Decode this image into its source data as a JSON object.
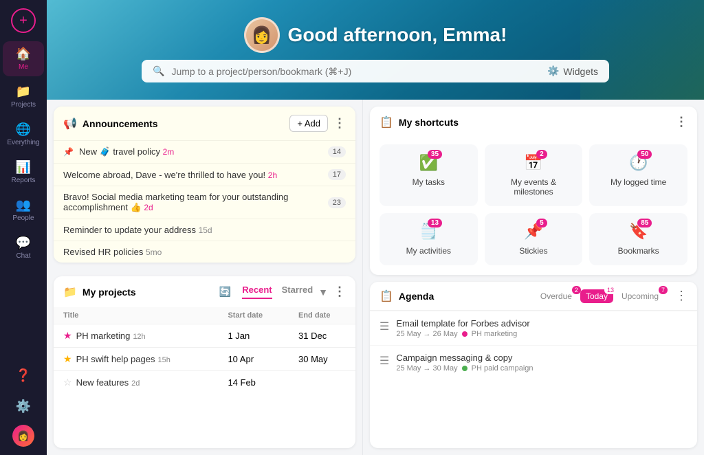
{
  "sidebar": {
    "add_label": "+",
    "items": [
      {
        "id": "me",
        "icon": "🏠",
        "label": "Me",
        "active": true
      },
      {
        "id": "projects",
        "icon": "📁",
        "label": "Projects",
        "active": false
      },
      {
        "id": "everything",
        "icon": "🌐",
        "label": "Everything",
        "active": false
      },
      {
        "id": "reports",
        "icon": "📊",
        "label": "Reports",
        "active": false
      },
      {
        "id": "people",
        "icon": "👥",
        "label": "People",
        "active": false
      },
      {
        "id": "chat",
        "icon": "💬",
        "label": "Chat",
        "active": false
      }
    ],
    "bottom": [
      {
        "id": "help",
        "icon": "❓"
      },
      {
        "id": "settings",
        "icon": "⚙️"
      }
    ]
  },
  "hero": {
    "greeting": "Good afternoon, Emma!",
    "avatar_emoji": "👩"
  },
  "search": {
    "placeholder": "Jump to a project/person/bookmark (⌘+J)",
    "widgets_label": "Widgets"
  },
  "announcements": {
    "title": "Announcements",
    "add_label": "+ Add",
    "items": [
      {
        "pinned": true,
        "text": "New 🧳 travel policy",
        "time": "2m",
        "count": "14"
      },
      {
        "pinned": false,
        "text": "Welcome abroad, Dave - we're thrilled to have you!",
        "time": "2h",
        "count": "17"
      },
      {
        "pinned": false,
        "text": "Bravo! Social media marketing team for your outstanding accomplishment 👍",
        "time": "2d",
        "count": "23"
      },
      {
        "pinned": false,
        "text": "Reminder to update your address",
        "time": "15d",
        "count": ""
      },
      {
        "pinned": false,
        "text": "Revised HR policies",
        "time": "5mo",
        "count": ""
      }
    ]
  },
  "shortcuts": {
    "title": "My shortcuts",
    "items": [
      {
        "icon": "✅",
        "label": "My tasks",
        "badge": "35"
      },
      {
        "icon": "📅",
        "label": "My events & milestones",
        "badge": "2"
      },
      {
        "icon": "🕐",
        "label": "My logged time",
        "badge": "50"
      },
      {
        "icon": "🗒️",
        "label": "My activities",
        "badge": "13"
      },
      {
        "icon": "📌",
        "label": "Stickies",
        "badge": "5"
      },
      {
        "icon": "🔖",
        "label": "Bookmarks",
        "badge": "85"
      }
    ]
  },
  "projects": {
    "title": "My projects",
    "tabs": [
      "Recent",
      "Starred"
    ],
    "active_tab": "Recent",
    "columns": [
      "Title",
      "Start date",
      "End date"
    ],
    "rows": [
      {
        "star": "filled",
        "name": "PH marketing",
        "time": "12h",
        "start": "1 Jan",
        "end": "31 Dec"
      },
      {
        "star": "half",
        "name": "PH swift help pages",
        "time": "15h",
        "start": "10 Apr",
        "end": "30 May"
      },
      {
        "star": "empty",
        "name": "New features",
        "time": "2d",
        "start": "14 Feb",
        "end": ""
      }
    ]
  },
  "agenda": {
    "title": "Agenda",
    "tabs": [
      {
        "label": "Overdue",
        "badge": "2",
        "active": false
      },
      {
        "label": "Today",
        "badge": "13",
        "active": true
      },
      {
        "label": "Upcoming",
        "badge": "7",
        "active": false
      }
    ],
    "items": [
      {
        "title": "Email template for Forbes advisor",
        "date_range": "25 May → 26 May",
        "project": "PH marketing",
        "dot_color": "#e91e8c"
      },
      {
        "title": "Campaign messaging & copy",
        "date_range": "25 May → 30 May",
        "project": "PH paid campaign",
        "dot_color": "#4caf50"
      }
    ]
  }
}
